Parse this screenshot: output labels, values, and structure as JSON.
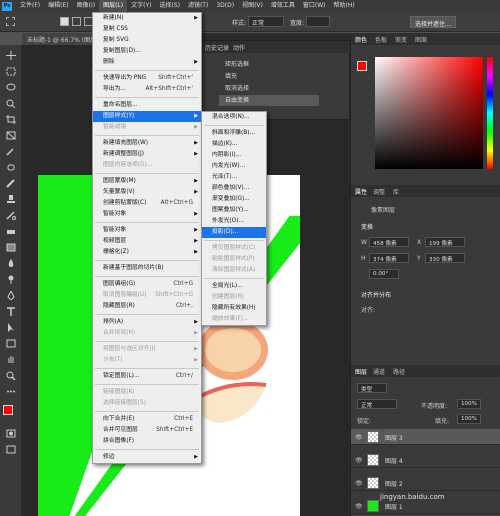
{
  "menubar": {
    "logo": "Ps",
    "items": [
      "文件(F)",
      "编辑(E)",
      "图像(I)",
      "图层(L)",
      "文字(Y)",
      "选择(S)",
      "滤镜(T)",
      "3D(D)",
      "视图(V)",
      "增效工具",
      "窗口(W)",
      "帮助(H)"
    ],
    "active_index": 3
  },
  "options_bar": {
    "style_label": "样式:",
    "style_value": "正常",
    "width_label": "宽度:",
    "height_label": "高度:",
    "select_mask_button": "选择并遮住..."
  },
  "document_tab": {
    "title": "未标题-1 @ 66.7% (图层 3, RGB/8#)"
  },
  "layer_menu": {
    "items": [
      {
        "label": "新建(N)",
        "shortcut": "",
        "submenu": true,
        "disabled": false
      },
      {
        "label": "复制 CSS",
        "shortcut": "",
        "submenu": false,
        "disabled": false
      },
      {
        "label": "复制 SVG",
        "shortcut": "",
        "submenu": false,
        "disabled": false
      },
      {
        "label": "复制图层(D)...",
        "shortcut": "",
        "submenu": false,
        "disabled": false
      },
      {
        "label": "删除",
        "shortcut": "",
        "submenu": true,
        "disabled": false
      },
      {
        "sep": true
      },
      {
        "label": "快速导出为 PNG",
        "shortcut": "Shift+Ctrl+'",
        "submenu": false,
        "disabled": false
      },
      {
        "label": "导出为...",
        "shortcut": "Alt+Shift+Ctrl+'",
        "submenu": false,
        "disabled": false
      },
      {
        "sep": true
      },
      {
        "label": "重命名图层...",
        "shortcut": "",
        "submenu": false,
        "disabled": false
      },
      {
        "label": "图层样式(Y)",
        "shortcut": "",
        "submenu": true,
        "disabled": false,
        "highlight": true
      },
      {
        "label": "智能滤镜",
        "shortcut": "",
        "submenu": true,
        "disabled": true
      },
      {
        "sep": true
      },
      {
        "label": "新建填充图层(W)",
        "shortcut": "",
        "submenu": true,
        "disabled": false
      },
      {
        "label": "新建调整图层(J)",
        "shortcut": "",
        "submenu": true,
        "disabled": false
      },
      {
        "label": "图层内容选项(O)...",
        "shortcut": "",
        "submenu": false,
        "disabled": true
      },
      {
        "sep": true
      },
      {
        "label": "图层蒙版(M)",
        "shortcut": "",
        "submenu": true,
        "disabled": false
      },
      {
        "label": "矢量蒙版(V)",
        "shortcut": "",
        "submenu": true,
        "disabled": false
      },
      {
        "label": "创建剪贴蒙版(C)",
        "shortcut": "Alt+Ctrl+G",
        "submenu": false,
        "disabled": false
      },
      {
        "label": "智能对象",
        "shortcut": "",
        "submenu": true,
        "disabled": false
      },
      {
        "sep": true
      },
      {
        "label": "智能对象",
        "shortcut": "",
        "submenu": true,
        "disabled": false
      },
      {
        "label": "视频图层",
        "shortcut": "",
        "submenu": true,
        "disabled": false
      },
      {
        "label": "栅格化(Z)",
        "shortcut": "",
        "submenu": true,
        "disabled": false
      },
      {
        "sep": true
      },
      {
        "label": "新建基于图层的切片(B)",
        "shortcut": "",
        "submenu": false,
        "disabled": false
      },
      {
        "sep": true
      },
      {
        "label": "图层编组(G)",
        "shortcut": "Ctrl+G",
        "submenu": false,
        "disabled": false
      },
      {
        "label": "取消图层编组(U)",
        "shortcut": "Shift+Ctrl+G",
        "submenu": false,
        "disabled": true
      },
      {
        "label": "隐藏图层(R)",
        "shortcut": "Ctrl+,",
        "submenu": false,
        "disabled": false
      },
      {
        "sep": true
      },
      {
        "label": "排列(A)",
        "shortcut": "",
        "submenu": true,
        "disabled": false
      },
      {
        "label": "合并形状(H)",
        "shortcut": "",
        "submenu": true,
        "disabled": true
      },
      {
        "sep": true
      },
      {
        "label": "将图层与选区对齐(I)",
        "shortcut": "",
        "submenu": true,
        "disabled": true
      },
      {
        "label": "分布(T)",
        "shortcut": "",
        "submenu": true,
        "disabled": true
      },
      {
        "sep": true
      },
      {
        "label": "锁定图层(L)...",
        "shortcut": "Ctrl+/",
        "submenu": false,
        "disabled": false
      },
      {
        "sep": true
      },
      {
        "label": "链接图层(K)",
        "shortcut": "",
        "submenu": false,
        "disabled": true
      },
      {
        "label": "选择链接图层(S)",
        "shortcut": "",
        "submenu": false,
        "disabled": true
      },
      {
        "sep": true
      },
      {
        "label": "向下合并(E)",
        "shortcut": "Ctrl+E",
        "submenu": false,
        "disabled": false
      },
      {
        "label": "合并可见图层",
        "shortcut": "Shift+Ctrl+E",
        "submenu": false,
        "disabled": false
      },
      {
        "label": "拼合图像(F)",
        "shortcut": "",
        "submenu": false,
        "disabled": false
      },
      {
        "sep": true
      },
      {
        "label": "修边",
        "shortcut": "",
        "submenu": true,
        "disabled": false
      }
    ]
  },
  "style_submenu": {
    "items": [
      {
        "label": "混合选项(N)...",
        "disabled": false
      },
      {
        "sep": true
      },
      {
        "label": "斜面和浮雕(B)...",
        "disabled": false
      },
      {
        "label": "描边(K)...",
        "disabled": false
      },
      {
        "label": "内阴影(I)...",
        "disabled": false
      },
      {
        "label": "内发光(W)...",
        "disabled": false
      },
      {
        "label": "光泽(T)...",
        "disabled": false
      },
      {
        "label": "颜色叠加(V)...",
        "disabled": false
      },
      {
        "label": "渐变叠加(G)...",
        "disabled": false
      },
      {
        "label": "图案叠加(Y)...",
        "disabled": false
      },
      {
        "label": "外发光(O)...",
        "disabled": false
      },
      {
        "label": "投影(D)...",
        "disabled": false,
        "highlight": true
      },
      {
        "sep": true
      },
      {
        "label": "拷贝图层样式(C)",
        "disabled": true
      },
      {
        "label": "粘贴图层样式(P)",
        "disabled": true
      },
      {
        "label": "清除图层样式(A)",
        "disabled": true
      },
      {
        "sep": true
      },
      {
        "label": "全局光(L)...",
        "disabled": false
      },
      {
        "label": "创建图层(R)",
        "disabled": true
      },
      {
        "label": "隐藏所有效果(H)",
        "disabled": false
      },
      {
        "label": "缩放效果(F)...",
        "disabled": true
      }
    ]
  },
  "history_panel": {
    "tabs": [
      "历史记录",
      "动作"
    ],
    "rows": [
      "矩形选框",
      "填充",
      "取消选择",
      "自由变换"
    ]
  },
  "color_panel": {
    "tabs": [
      "颜色",
      "色板",
      "渐变",
      "图案"
    ],
    "foreground": "#ff0000",
    "background": "#ffffff"
  },
  "properties_panel": {
    "tabs": [
      "属性",
      "调整",
      "库"
    ],
    "kind": "像素图层",
    "transform_label": "变换",
    "w_label": "W",
    "w_value": "458 像素",
    "x_label": "X",
    "x_value": "199 像素",
    "h_label": "H",
    "h_value": "374 像素",
    "y_label": "Y",
    "y_value": "330 像素",
    "angle": "0.00°",
    "align_label": "对齐并分布",
    "align_sub": "对齐:"
  },
  "layers_panel": {
    "tabs": [
      "图层",
      "通道",
      "路径"
    ],
    "kind_label": "类型",
    "blend_mode": "正常",
    "opacity_label": "不透明度:",
    "opacity_value": "100%",
    "lock_label": "锁定:",
    "fill_label": "填充:",
    "fill_value": "100%",
    "layers": [
      {
        "name": "图层 3",
        "selected": true
      },
      {
        "name": "图层 4",
        "selected": false
      },
      {
        "name": "图层 2",
        "selected": false
      },
      {
        "name": "图层 1",
        "selected": false
      }
    ]
  },
  "watermark": "jingyan.baidu.com"
}
